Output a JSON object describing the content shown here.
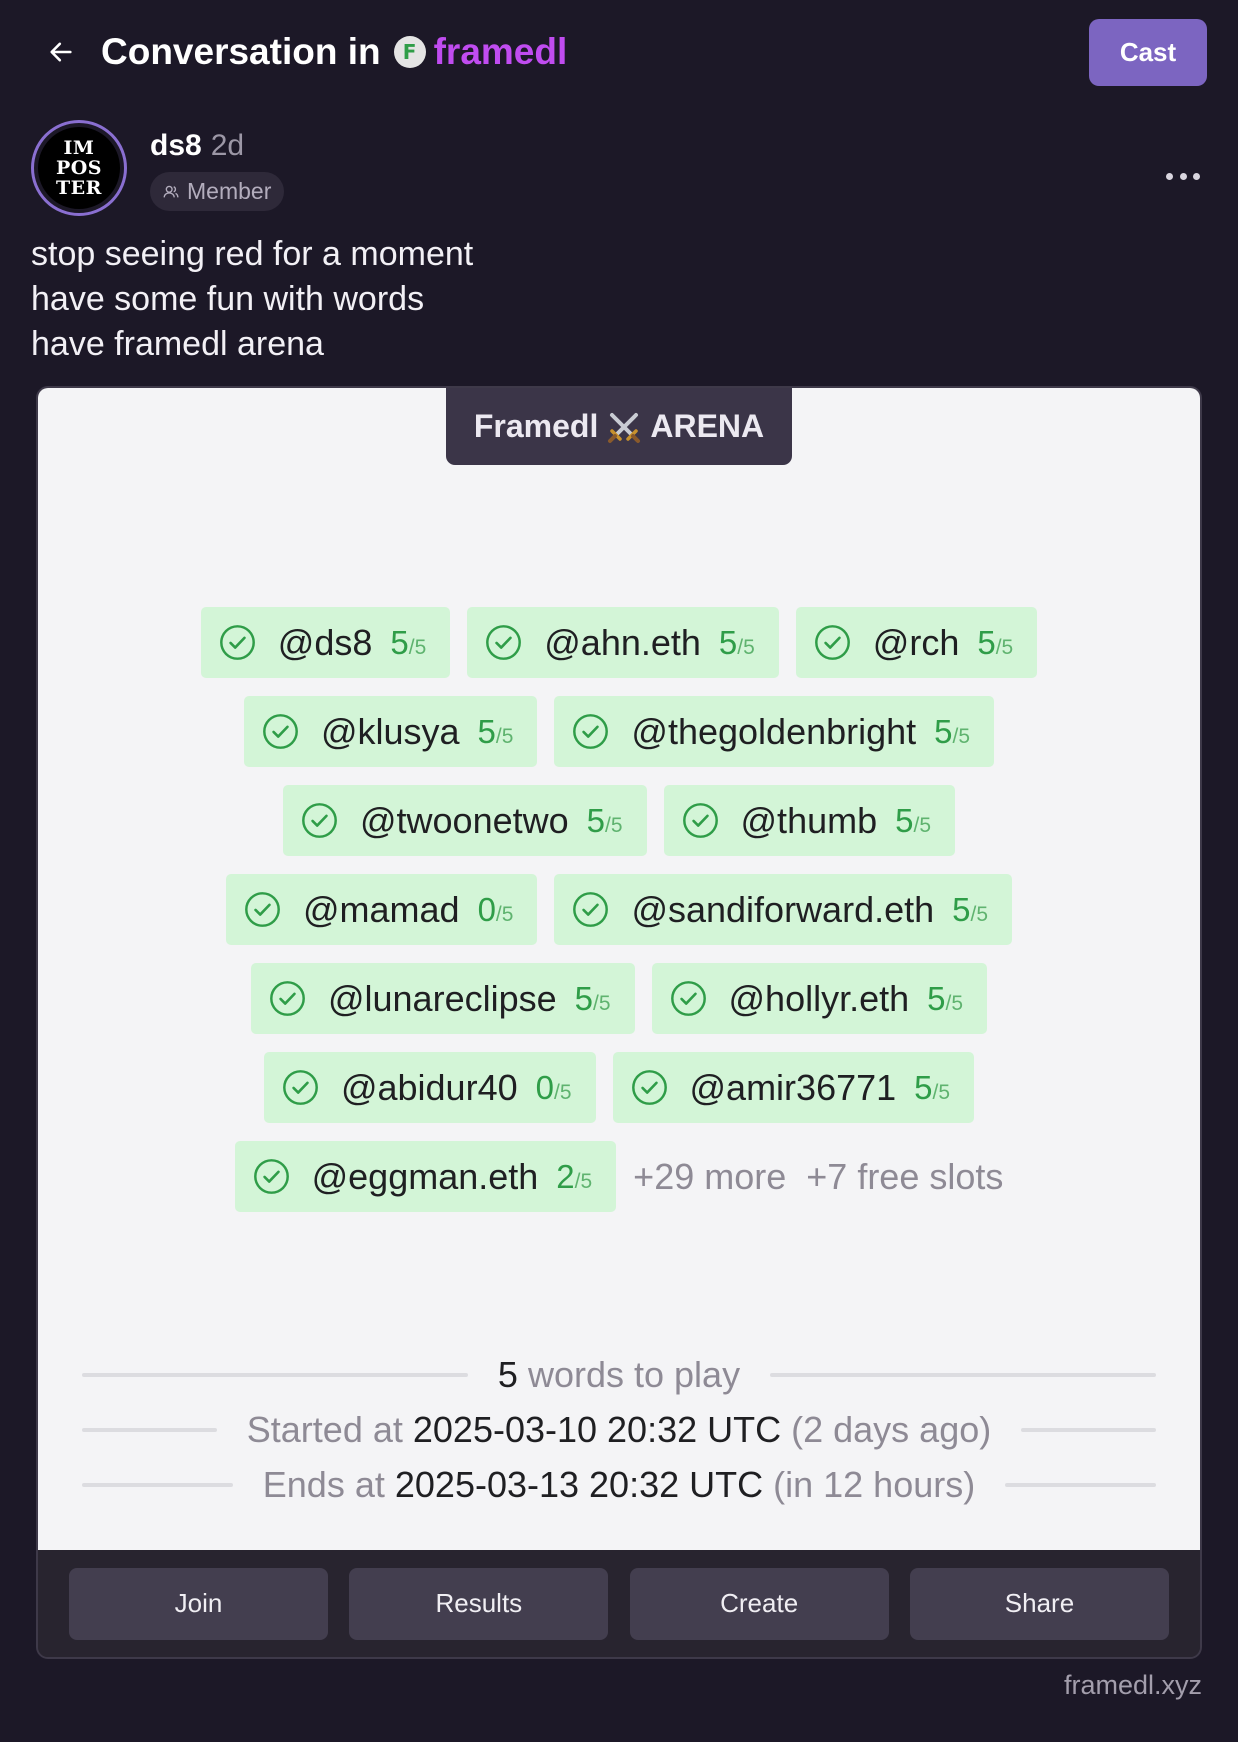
{
  "header": {
    "back_icon": "arrow-left-icon",
    "title": "Conversation in",
    "channel_logo_letter": "F",
    "channel_name": "framedl",
    "cast_label": "Cast",
    "more_icon": "more-horizontal-icon"
  },
  "colors": {
    "background": "#1c1827",
    "accent": "#7c65c1",
    "channel": "#c04cf0",
    "pill_bg": "#d3f5d7",
    "check": "#2f9d48",
    "frame_bg": "#f4f4f6"
  },
  "post": {
    "avatar_text": [
      "IM",
      "POS",
      "TER"
    ],
    "author": "ds8",
    "time_ago": "2d",
    "badge_icon": "members-icon",
    "badge": "Member",
    "text_lines": [
      "stop seeing red for a moment",
      "have some fun with words",
      "have framedl arena"
    ]
  },
  "frame": {
    "banner_left": "Framedl",
    "banner_icon": "crossed-swords-icon",
    "banner_right": "ARENA",
    "players": [
      {
        "handle": "@ds8",
        "score": 5,
        "total": 5
      },
      {
        "handle": "@ahn.eth",
        "score": 5,
        "total": 5
      },
      {
        "handle": "@rch",
        "score": 5,
        "total": 5
      },
      {
        "handle": "@klusya",
        "score": 5,
        "total": 5
      },
      {
        "handle": "@thegoldenbright",
        "score": 5,
        "total": 5
      },
      {
        "handle": "@twoonetwo",
        "score": 5,
        "total": 5
      },
      {
        "handle": "@thumb",
        "score": 5,
        "total": 5
      },
      {
        "handle": "@mamad",
        "score": 0,
        "total": 5
      },
      {
        "handle": "@sandiforward.eth",
        "score": 5,
        "total": 5
      },
      {
        "handle": "@lunareclipse",
        "score": 5,
        "total": 5
      },
      {
        "handle": "@hollyr.eth",
        "score": 5,
        "total": 5
      },
      {
        "handle": "@abidur40",
        "score": 0,
        "total": 5
      },
      {
        "handle": "@amir36771",
        "score": 5,
        "total": 5
      },
      {
        "handle": "@eggman.eth",
        "score": 2,
        "total": 5
      }
    ],
    "more_players": "+29 more",
    "free_slots": "+7 free slots",
    "words_count": "5",
    "words_label": "words to play",
    "started_prefix": "Started at",
    "started_at": "2025-03-10 20:32 UTC",
    "started_relative": "(2 days ago)",
    "ends_prefix": "Ends at",
    "ends_at": "2025-03-13 20:32 UTC",
    "ends_relative": "(in 12 hours)",
    "buttons": [
      "Join",
      "Results",
      "Create",
      "Share"
    ],
    "domain": "framedl.xyz"
  }
}
